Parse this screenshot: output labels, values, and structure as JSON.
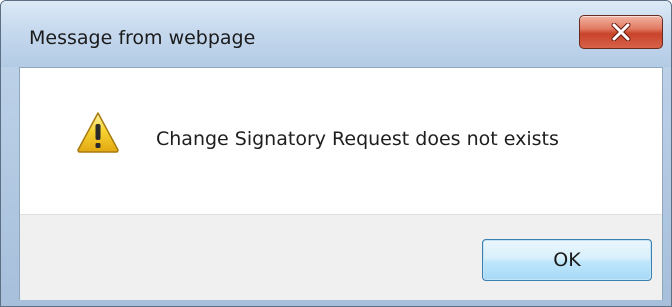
{
  "dialog": {
    "title": "Message from webpage",
    "message": "Change Signatory Request does not exists",
    "icon": "warning-icon",
    "ok_label": "OK",
    "close_icon": "close-icon"
  },
  "colors": {
    "close_button": "#c8432a",
    "ok_button_border": "#3c7fb1",
    "button_bar": "#f0f0f0",
    "warning_yellow": "#f7d331"
  }
}
